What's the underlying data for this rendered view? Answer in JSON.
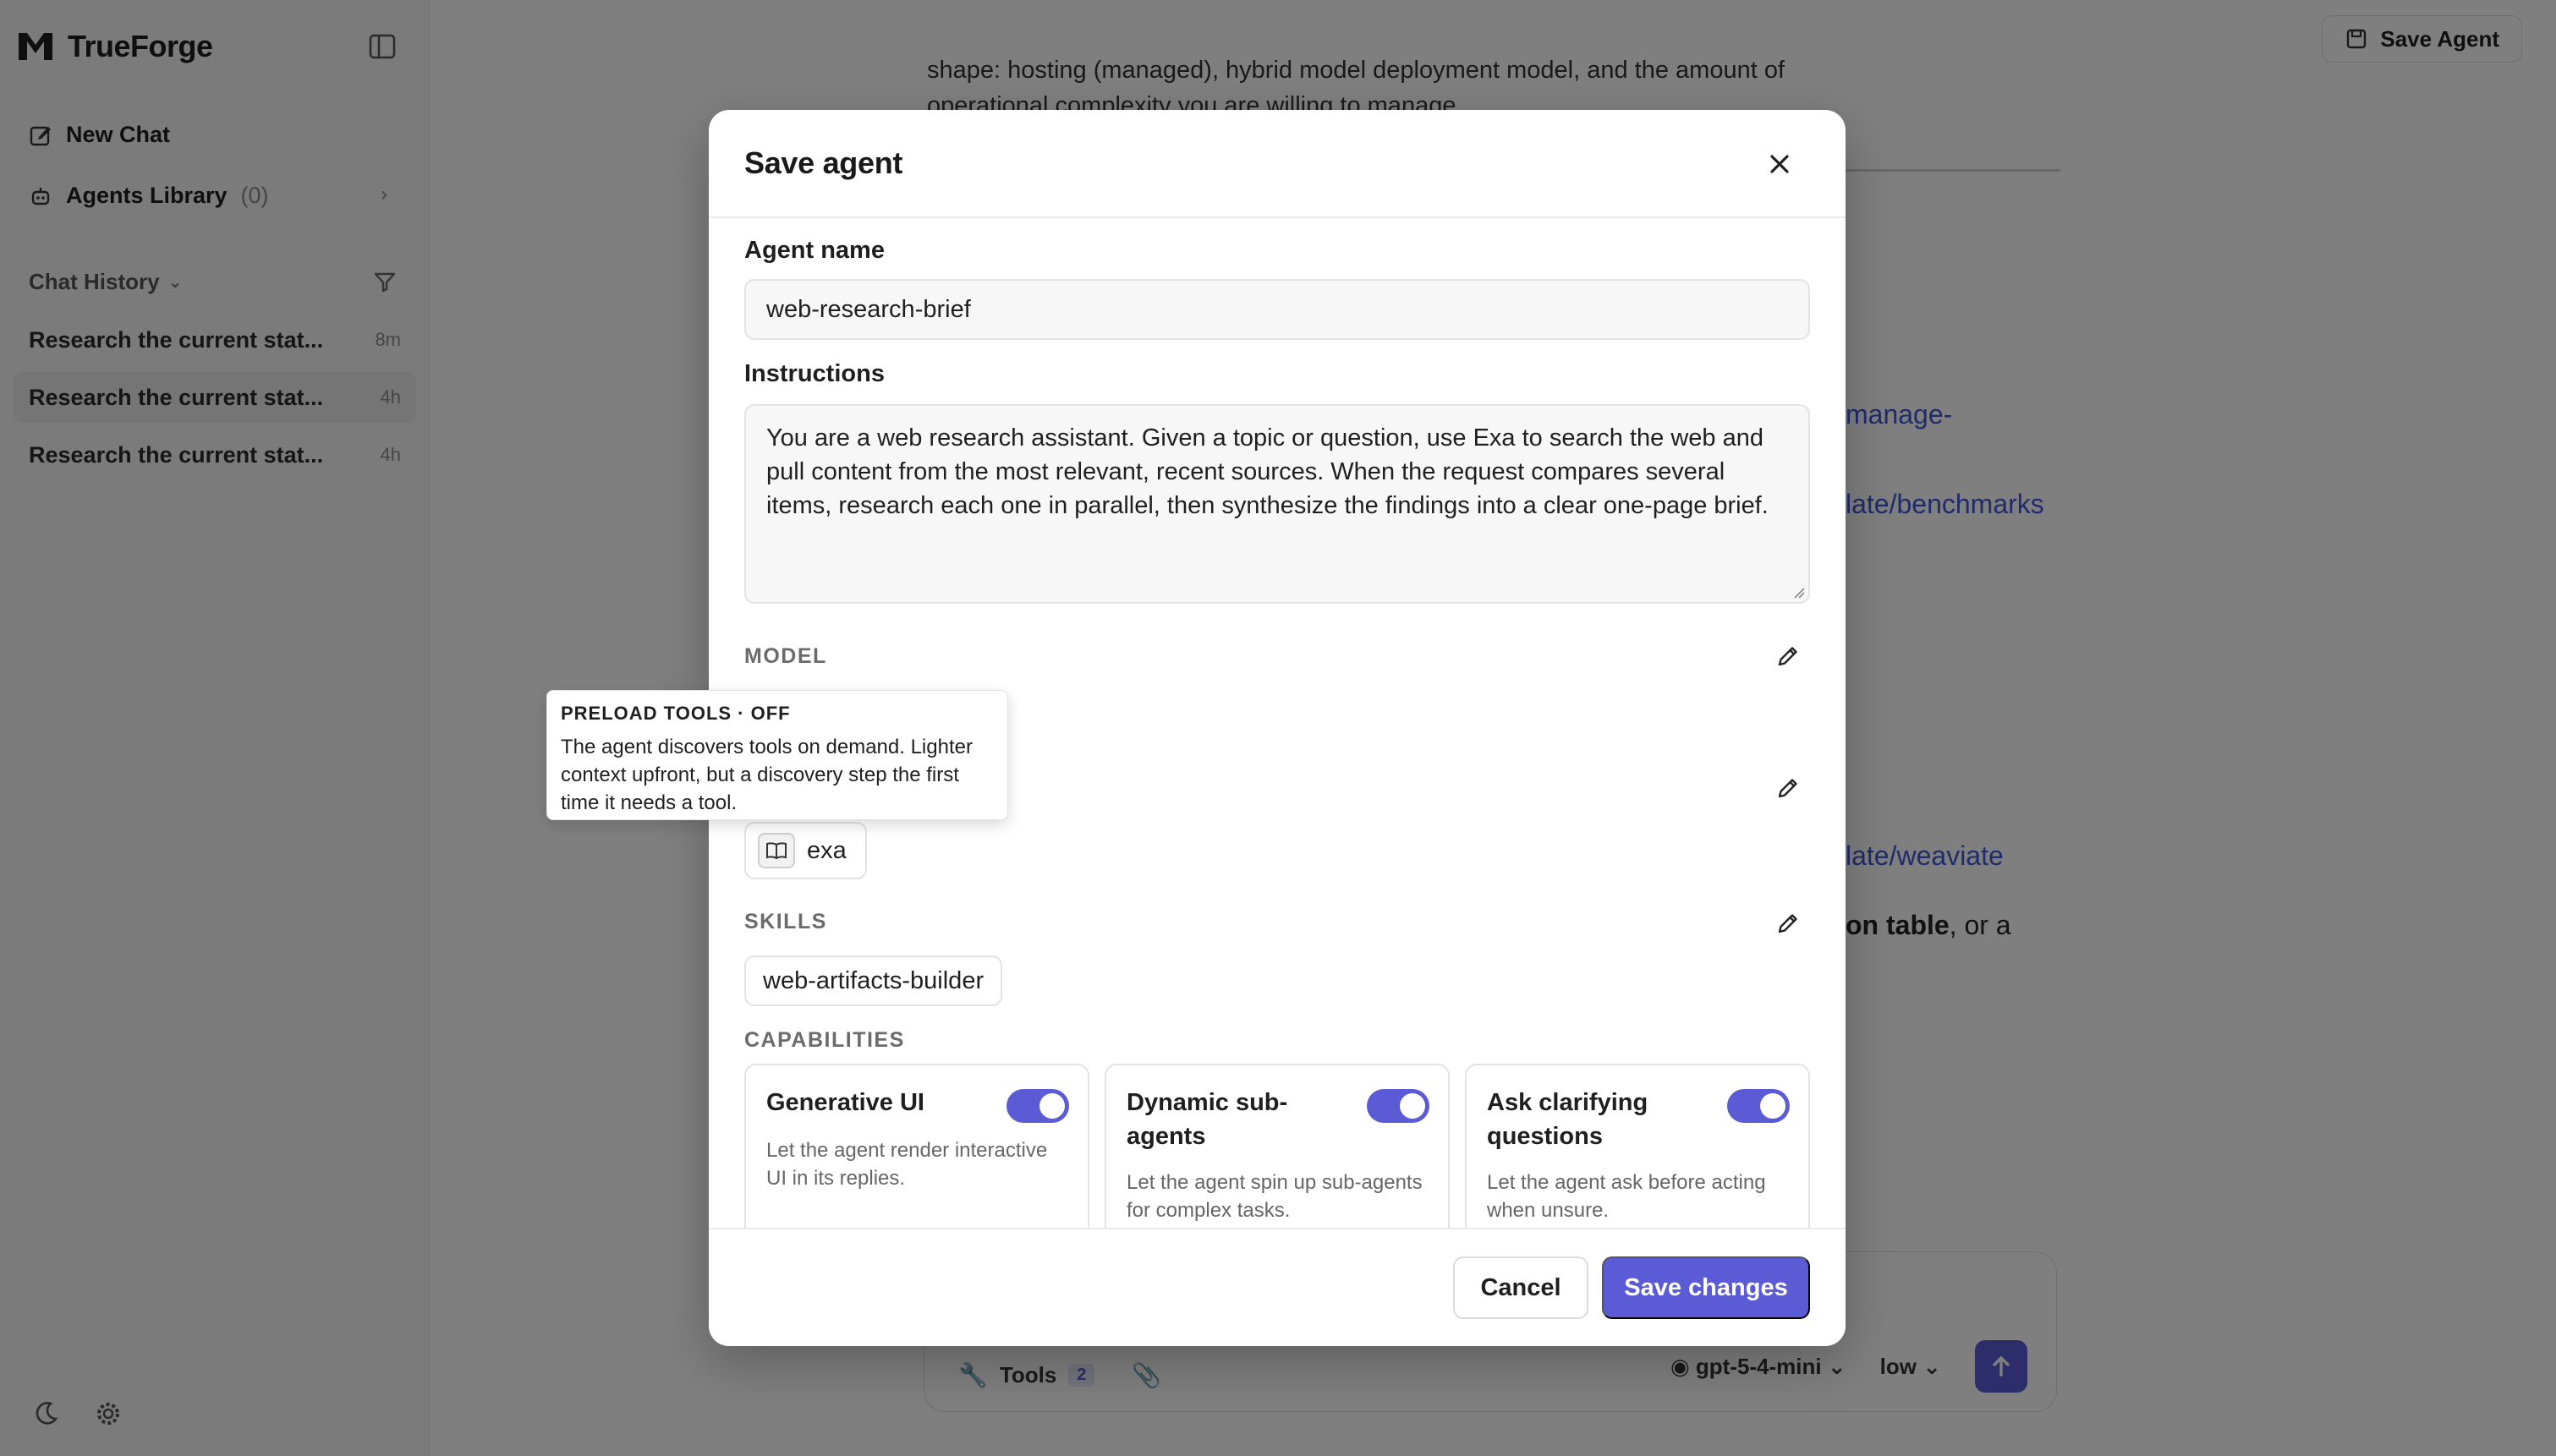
{
  "app": {
    "name": "TrueForge"
  },
  "sidebar": {
    "new_chat": "New Chat",
    "agents_library": "Agents Library",
    "agents_count": "(0)",
    "history_label": "Chat History",
    "history": [
      {
        "title": "Research the current stat...",
        "time": "8m"
      },
      {
        "title": "Research the current stat...",
        "time": "4h"
      },
      {
        "title": "Research the current stat...",
        "time": "4h"
      }
    ]
  },
  "main": {
    "save_agent_label": "Save Agent",
    "bg_text_1": "shape: hosting (managed), hybrid model deployment model, and the amount of",
    "bg_text_2": "operational complexity you are willing to manage.",
    "bg_link_1": "manage-",
    "bg_link_2": "late/benchmarks",
    "bg_link_3": "late/weaviate",
    "bg_body_bold": "on table",
    "bg_body_rest": ", or a",
    "composer": {
      "tools_label": "Tools",
      "tools_count": "2",
      "model": "gpt-5-4-mini",
      "effort": "low"
    }
  },
  "modal": {
    "title": "Save agent",
    "agent_name_label": "Agent name",
    "agent_name_value": "web-research-brief",
    "instructions_label": "Instructions",
    "instructions_value": "You are a web research assistant. Given a topic or question, use Exa to search the web and pull content from the most relevant, recent sources. When the request compares several items, research each one in parallel, then synthesize the findings into a clear one-page brief.",
    "model_label": "MODEL",
    "tools": [
      "exa"
    ],
    "skills_label": "SKILLS",
    "skills": [
      "web-artifacts-builder"
    ],
    "capabilities_label": "CAPABILITIES",
    "capabilities": [
      {
        "title": "Generative UI",
        "desc": "Let the agent render interactive UI in its replies.",
        "enabled": true
      },
      {
        "title": "Dynamic sub-agents",
        "desc": "Let the agent spin up sub-agents for complex tasks.",
        "enabled": true
      },
      {
        "title": "Ask clarifying questions",
        "desc": "Let the agent ask before acting when unsure.",
        "enabled": true
      }
    ],
    "cancel_label": "Cancel",
    "save_label": "Save changes"
  },
  "tooltip": {
    "title": "PRELOAD TOOLS · OFF",
    "body": "The agent discovers tools on demand. Lighter context upfront, but a discovery step the first time it needs a tool."
  },
  "colors": {
    "accent": "#5b5bd6",
    "overlay": "rgba(0,0,0,0.5)"
  }
}
